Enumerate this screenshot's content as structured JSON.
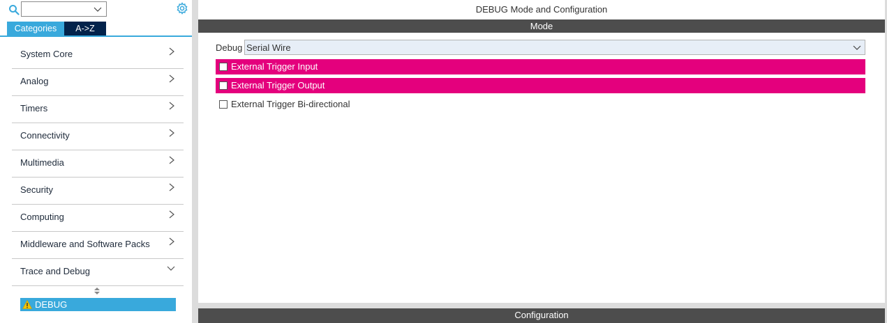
{
  "left_panel": {
    "search": {
      "value": ""
    },
    "tabs": {
      "categories": "Categories",
      "az": "A->Z"
    },
    "categories": [
      {
        "label": "System Core",
        "state": "collapsed"
      },
      {
        "label": "Analog",
        "state": "collapsed"
      },
      {
        "label": "Timers",
        "state": "collapsed"
      },
      {
        "label": "Connectivity",
        "state": "collapsed"
      },
      {
        "label": "Multimedia",
        "state": "collapsed"
      },
      {
        "label": "Security",
        "state": "collapsed"
      },
      {
        "label": "Computing",
        "state": "collapsed"
      },
      {
        "label": "Middleware and Software Packs",
        "state": "collapsed"
      },
      {
        "label": "Trace and Debug",
        "state": "expanded"
      }
    ],
    "selected_item": {
      "label": "DEBUG",
      "icon": "warning-icon"
    }
  },
  "right_panel": {
    "title": "DEBUG Mode and Configuration",
    "mode_header": "Mode",
    "debug_label": "Debug",
    "debug_value": "Serial Wire",
    "options": [
      {
        "label": "External Trigger Input",
        "checked": false,
        "highlighted": true
      },
      {
        "label": "External Trigger Output",
        "checked": false,
        "highlighted": true
      },
      {
        "label": "External Trigger Bi-directional",
        "checked": false,
        "highlighted": false
      }
    ],
    "config_header": "Configuration"
  },
  "colors": {
    "accent": "#39a9dc",
    "tab_dark": "#03234b",
    "highlight": "#e4007d",
    "header_bar": "#4d4d4d",
    "select_bg": "#e7eef7",
    "warning": "#f5c400"
  }
}
